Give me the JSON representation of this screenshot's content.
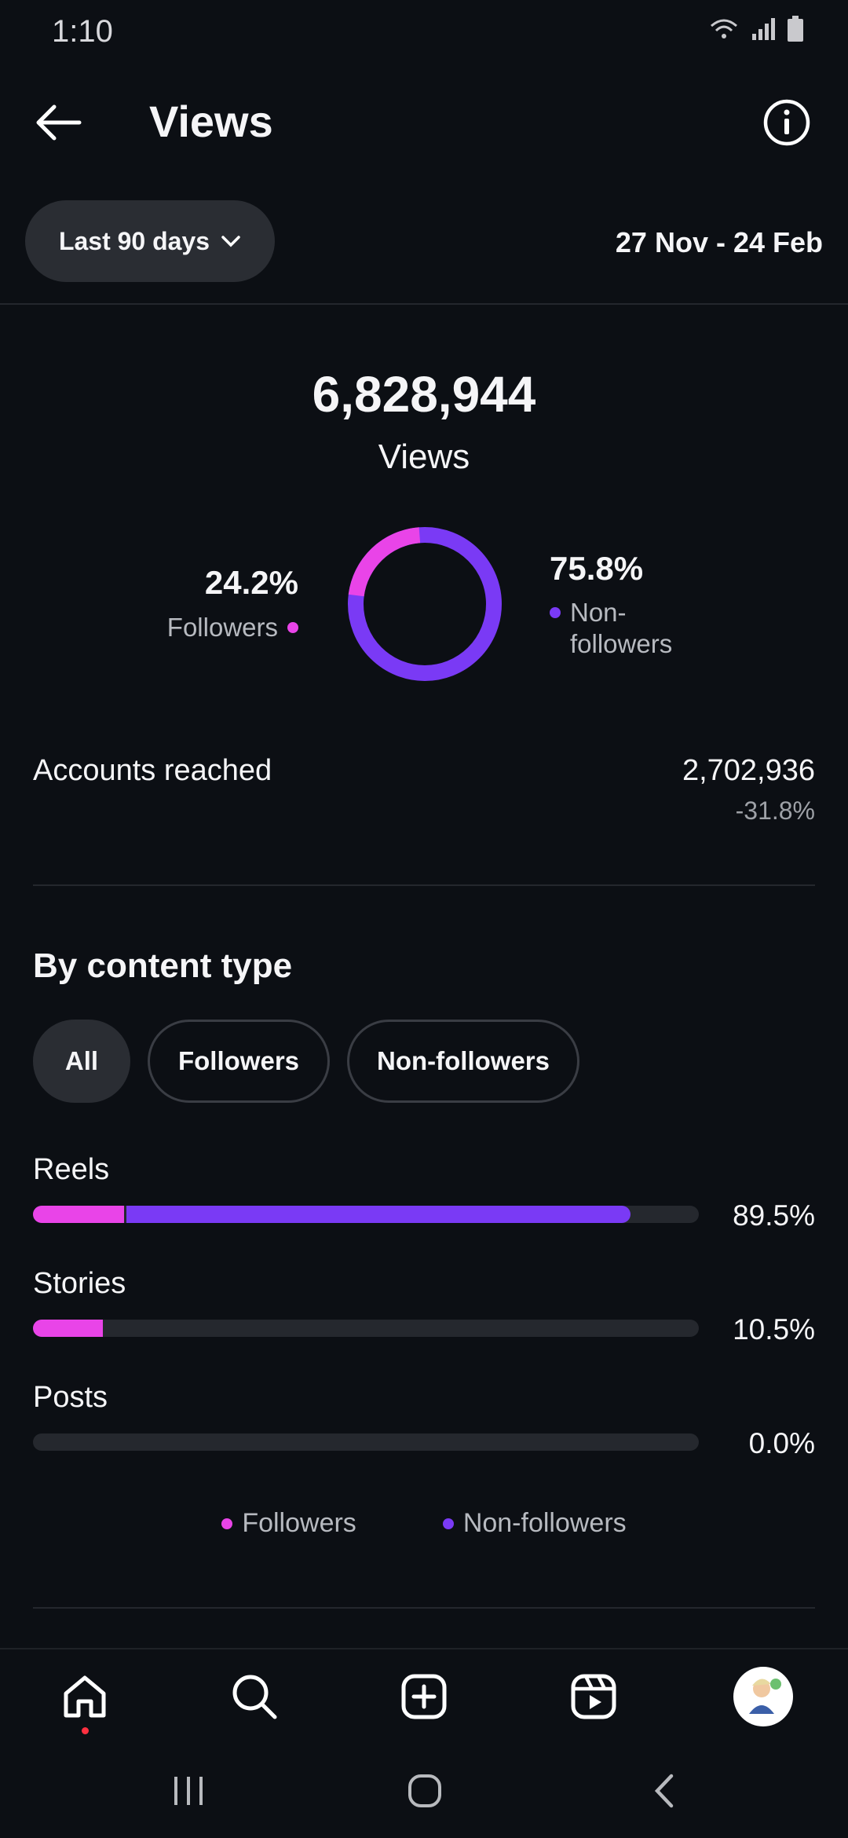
{
  "status_bar": {
    "time": "1:10"
  },
  "header": {
    "title": "Views"
  },
  "range": {
    "selected": "Last 90 days",
    "dates": "27 Nov - 24 Feb"
  },
  "summary": {
    "total": "6,828,944",
    "label": "Views",
    "followers_pct": "24.2%",
    "followers_label": "Followers",
    "non_followers_pct": "75.8%",
    "non_followers_label_1": "Non-",
    "non_followers_label_2": "followers",
    "followers_fraction": 0.242
  },
  "accounts_reached": {
    "label": "Accounts reached",
    "value": "2,702,936",
    "change": "-31.8%"
  },
  "content_type": {
    "title": "By content type",
    "chips": [
      "All",
      "Followers",
      "Non-followers"
    ],
    "rows": [
      {
        "label": "Reels",
        "pct": "89.5%",
        "followers": 0.137,
        "non_followers": 0.76
      },
      {
        "label": "Stories",
        "pct": "10.5%",
        "followers": 0.105,
        "non_followers": 0.0
      },
      {
        "label": "Posts",
        "pct": "0.0%",
        "followers": 0.0,
        "non_followers": 0.0
      }
    ],
    "legend": [
      "Followers",
      "Non-followers"
    ]
  },
  "colors": {
    "followers": "#e944e8",
    "non_followers": "#7a3af5",
    "background": "#0c0f14"
  },
  "bottom_nav": [
    "home-icon",
    "search-icon",
    "create-icon",
    "reels-icon",
    "profile-avatar"
  ]
}
